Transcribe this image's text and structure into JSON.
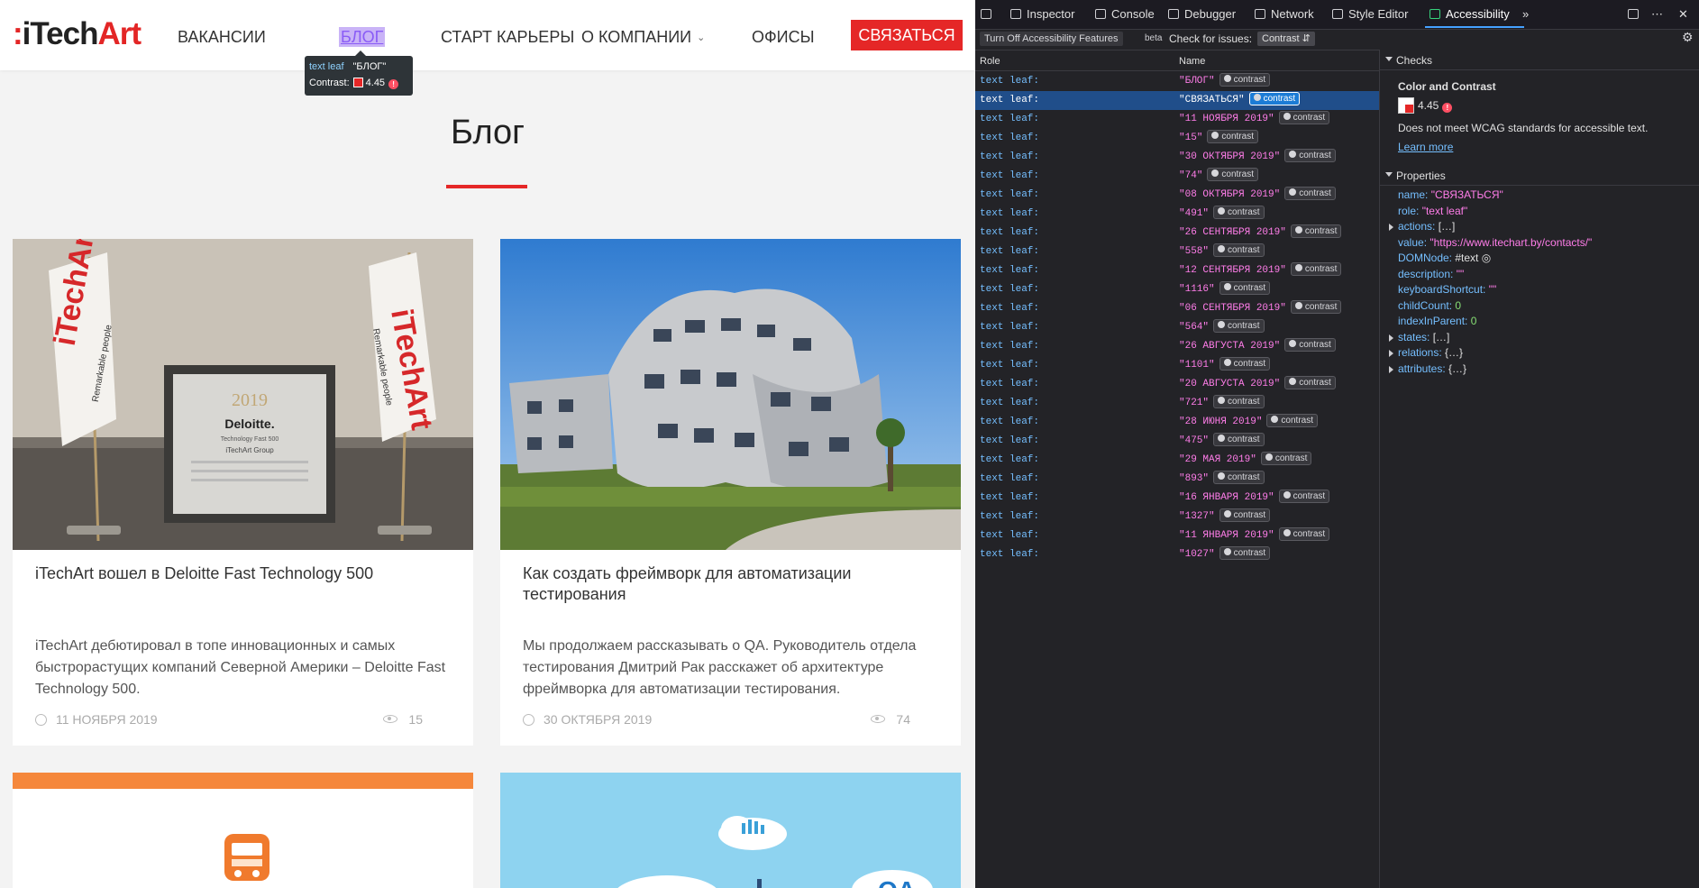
{
  "site": {
    "logo": {
      "dots": ":",
      "text": "iTech",
      "accent": "Art"
    },
    "nav": [
      {
        "label": "ВАКАНСИИ"
      },
      {
        "label": "БЛОГ"
      },
      {
        "label": "СТАРТ КАРЬЕРЫ"
      },
      {
        "label": "О КОМПАНИИ"
      },
      {
        "label": "ОФИСЫ"
      }
    ],
    "cta": "СВЯЗАТЬСЯ",
    "page_title": "Блог",
    "tooltip": {
      "role": "text leaf",
      "name": "\"БЛОГ\"",
      "contrast_label": "Contrast:",
      "contrast_value": "4.45"
    },
    "cards": [
      {
        "title": "iTechArt вошел в Deloitte Fast Technology 500",
        "desc": "iTechArt дебютировал в топе инновационных и самых быстрорастущих компаний Северной Америки – Deloitte Fast Technology 500.",
        "date": "11 НОЯБРЯ 2019",
        "views": "15",
        "image": "deloitte-award-photo",
        "image_text": {
          "flag": "iTechArt",
          "tagline": "Remarkable people",
          "year": "2019",
          "brand": "Deloitte.",
          "sub": "Technology Fast 500",
          "company": "iTechArt Group"
        }
      },
      {
        "title": "Как создать фреймворк для автоматизации тестирования",
        "desc": "Мы продолжаем рассказывать о QA. Руководитель отдела тестирования Дмитрий Рак расскажет об архитектуре фреймворка для автоматизации тестирования.",
        "date": "30 ОКТЯБРЯ 2019",
        "views": "74",
        "image": "wavy-building-photo"
      },
      {
        "image": "bus-icon-banner"
      },
      {
        "image": "qa-cloud-banner",
        "image_text": {
          "qa": "QA"
        }
      }
    ]
  },
  "devtools": {
    "tabs": [
      {
        "label": "Inspector",
        "icon": "inspector-icon"
      },
      {
        "label": "Console",
        "icon": "console-icon"
      },
      {
        "label": "Debugger",
        "icon": "debugger-icon"
      },
      {
        "label": "Network",
        "icon": "network-icon"
      },
      {
        "label": "Style Editor",
        "icon": "style-editor-icon"
      },
      {
        "label": "Accessibility",
        "icon": "accessibility-icon"
      }
    ],
    "turn_off_btn": "Turn Off Accessibility Features",
    "beta": "beta",
    "check_label": "Check for issues:",
    "check_value": "Contrast",
    "columns": {
      "role": "Role",
      "name": "Name"
    },
    "rows": [
      {
        "role": "text leaf:",
        "name": "\"БЛОГ\"",
        "badge": "contrast"
      },
      {
        "role": "text leaf:",
        "name": "\"СВЯЗАТЬСЯ\"",
        "badge": "contrast"
      },
      {
        "role": "text leaf:",
        "name": "\"11 НОЯБРЯ 2019\"",
        "badge": "contrast"
      },
      {
        "role": "text leaf:",
        "name": "\"15\"",
        "badge": "contrast"
      },
      {
        "role": "text leaf:",
        "name": "\"30 ОКТЯБРЯ 2019\"",
        "badge": "contrast"
      },
      {
        "role": "text leaf:",
        "name": "\"74\"",
        "badge": "contrast"
      },
      {
        "role": "text leaf:",
        "name": "\"08 ОКТЯБРЯ 2019\"",
        "badge": "contrast"
      },
      {
        "role": "text leaf:",
        "name": "\"491\"",
        "badge": "contrast"
      },
      {
        "role": "text leaf:",
        "name": "\"26 СЕНТЯБРЯ 2019\"",
        "badge": "contrast"
      },
      {
        "role": "text leaf:",
        "name": "\"558\"",
        "badge": "contrast"
      },
      {
        "role": "text leaf:",
        "name": "\"12 СЕНТЯБРЯ 2019\"",
        "badge": "contrast"
      },
      {
        "role": "text leaf:",
        "name": "\"1116\"",
        "badge": "contrast"
      },
      {
        "role": "text leaf:",
        "name": "\"06 СЕНТЯБРЯ 2019\"",
        "badge": "contrast"
      },
      {
        "role": "text leaf:",
        "name": "\"564\"",
        "badge": "contrast"
      },
      {
        "role": "text leaf:",
        "name": "\"26 АВГУСТА 2019\"",
        "badge": "contrast"
      },
      {
        "role": "text leaf:",
        "name": "\"1101\"",
        "badge": "contrast"
      },
      {
        "role": "text leaf:",
        "name": "\"20 АВГУСТА 2019\"",
        "badge": "contrast"
      },
      {
        "role": "text leaf:",
        "name": "\"721\"",
        "badge": "contrast"
      },
      {
        "role": "text leaf:",
        "name": "\"28 ИЮНЯ 2019\"",
        "badge": "contrast"
      },
      {
        "role": "text leaf:",
        "name": "\"475\"",
        "badge": "contrast"
      },
      {
        "role": "text leaf:",
        "name": "\"29 МАЯ 2019\"",
        "badge": "contrast"
      },
      {
        "role": "text leaf:",
        "name": "\"893\"",
        "badge": "contrast"
      },
      {
        "role": "text leaf:",
        "name": "\"16 ЯНВАРЯ 2019\"",
        "badge": "contrast"
      },
      {
        "role": "text leaf:",
        "name": "\"1327\"",
        "badge": "contrast"
      },
      {
        "role": "text leaf:",
        "name": "\"11 ЯНВАРЯ 2019\"",
        "badge": "contrast"
      },
      {
        "role": "text leaf:",
        "name": "\"1027\"",
        "badge": "contrast"
      }
    ],
    "selected_row": 1,
    "checks": {
      "title": "Checks",
      "heading": "Color and Contrast",
      "value": "4.45",
      "message": "Does not meet WCAG standards for accessible text.",
      "learn_more": "Learn more"
    },
    "properties": {
      "title": "Properties",
      "items": [
        {
          "key": "name:",
          "val": "\"СВЯЗАТЬСЯ\"",
          "kind": "s"
        },
        {
          "key": "role:",
          "val": "\"text leaf\"",
          "kind": "s"
        },
        {
          "key": "actions:",
          "val": "[…]",
          "kind": "p",
          "expandable": true
        },
        {
          "key": "value:",
          "val": "\"https://www.itechart.by/contacts/\"",
          "kind": "s"
        },
        {
          "key": "DOMNode:",
          "val": "#text",
          "kind": "p"
        },
        {
          "key": "description:",
          "val": "\"\"",
          "kind": "s"
        },
        {
          "key": "keyboardShortcut:",
          "val": "\"\"",
          "kind": "s"
        },
        {
          "key": "childCount:",
          "val": "0",
          "kind": "n"
        },
        {
          "key": "indexInParent:",
          "val": "0",
          "kind": "n"
        },
        {
          "key": "states:",
          "val": "[…]",
          "kind": "p",
          "expandable": true
        },
        {
          "key": "relations:",
          "val": "{…}",
          "kind": "p",
          "expandable": true
        },
        {
          "key": "attributes:",
          "val": "{…}",
          "kind": "p",
          "expandable": true
        }
      ]
    }
  },
  "colors": {
    "brand_red": "#e52727",
    "devtools_bg": "#232327",
    "selected_row": "#204e8a"
  }
}
